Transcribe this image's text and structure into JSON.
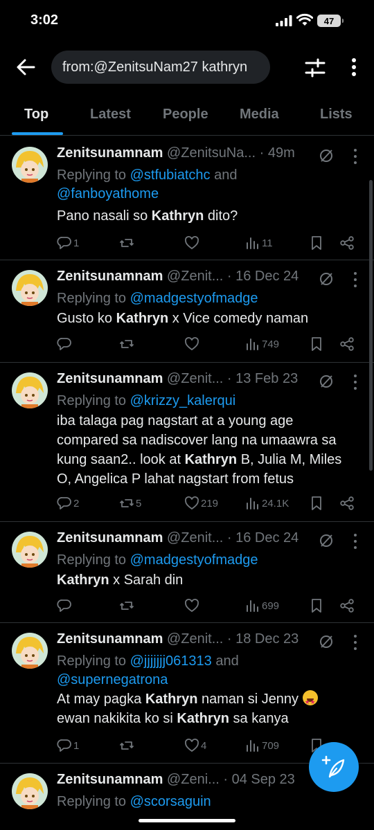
{
  "status_bar": {
    "time": "3:02",
    "battery": "47"
  },
  "header": {
    "search_value": "from:@ZenitsuNam27 kathryn"
  },
  "tabs": [
    {
      "label": "Top",
      "active": true
    },
    {
      "label": "Latest"
    },
    {
      "label": "People"
    },
    {
      "label": "Media"
    },
    {
      "label": "Lists"
    }
  ],
  "tweets": [
    {
      "name": "Zenitsunamnam",
      "handle": "@ZenitsuNa...",
      "time": "· 49m",
      "reply_prefix": "Replying to ",
      "reply_to_1": "@stfubiatchc",
      "reply_and": " and ",
      "reply_to_2": "@fanboyathome",
      "text_1": "Pano nasali so ",
      "bold_1": "Kathryn",
      "text_2": " dito?",
      "replies": "1",
      "retweets": "",
      "likes": "",
      "views": "11"
    },
    {
      "name": "Zenitsunamnam",
      "handle": "@Zenit...",
      "time": " · 16 Dec 24",
      "reply_prefix": "Replying to ",
      "reply_to_1": "@madgestyofmadge",
      "text_1": "Gusto ko ",
      "bold_1": "Kathryn",
      "text_2": " x Vice comedy naman",
      "replies": "",
      "retweets": "",
      "likes": "",
      "views": "749"
    },
    {
      "name": "Zenitsunamnam",
      "handle": "@Zenit...",
      "time": " · 13 Feb 23",
      "reply_prefix": "Replying to ",
      "reply_to_1": "@krizzy_kalerqui",
      "text_1": "iba talaga pag nagstart at a young age compared sa nadiscover lang na umaawra sa kung saan2.. look at ",
      "bold_1": "Kathryn",
      "text_2": " B, Julia M, Miles O, Angelica P lahat nagstart from fetus",
      "replies": "2",
      "retweets": "5",
      "likes": "219",
      "views": "24.1K"
    },
    {
      "name": "Zenitsunamnam",
      "handle": "@Zenit...",
      "time": " · 16 Dec 24",
      "reply_prefix": "Replying to ",
      "reply_to_1": "@madgestyofmadge",
      "text_1": "",
      "bold_1": "Kathryn",
      "text_2": " x Sarah din",
      "replies": "",
      "retweets": "",
      "likes": "",
      "views": "699"
    },
    {
      "name": "Zenitsunamnam",
      "handle": "@Zenit...",
      "time": " · 18 Dec 23",
      "reply_prefix": "Replying to ",
      "reply_to_1": "@jjjjjjj061313",
      "reply_and": " and ",
      "reply_to_2": "@supernegatrona",
      "text_1": "At may pagka ",
      "bold_1": "Kathryn",
      "text_2": " naman si Jenny ",
      "text_3": " ewan nakikita ko si ",
      "bold_2": "Kathryn",
      "text_4": " sa kanya",
      "replies": "1",
      "retweets": "",
      "likes": "4",
      "views": "709"
    },
    {
      "name": "Zenitsunamnam",
      "handle": "@Zeni...",
      "time": " · 04 Sep 23",
      "reply_prefix": "Replying to ",
      "reply_to_1": "@scorsaguin"
    }
  ]
}
